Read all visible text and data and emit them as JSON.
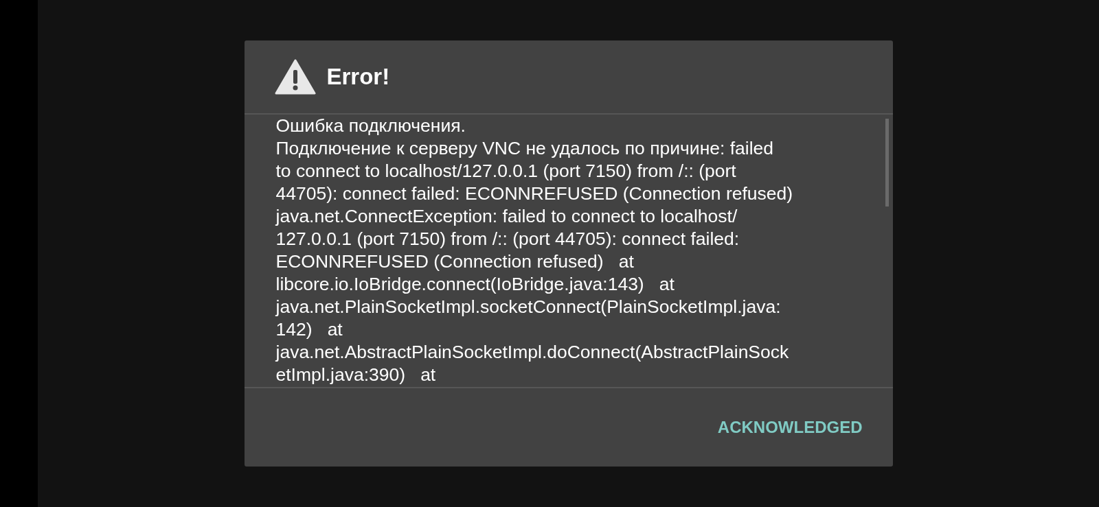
{
  "dialog": {
    "title": "Error!",
    "message_lines": [
      "Ошибка подключения.",
      "Подключение к серверу VNC не удалось по причине: failed",
      "to connect to localhost/127.0.0.1 (port 7150) from /:: (port",
      "44705): connect failed: ECONNREFUSED (Connection refused)",
      "java.net.ConnectException: failed to connect to localhost/",
      "127.0.0.1 (port 7150) from /:: (port 44705): connect failed:",
      "ECONNREFUSED (Connection refused)   at",
      "libcore.io.IoBridge.connect(IoBridge.java:143)   at",
      "java.net.PlainSocketImpl.socketConnect(PlainSocketImpl.java:",
      "142)   at",
      "java.net.AbstractPlainSocketImpl.doConnect(AbstractPlainSock",
      "etImpl.java:390)   at"
    ],
    "buttons": [
      "ACKNOWLEDGED"
    ]
  }
}
